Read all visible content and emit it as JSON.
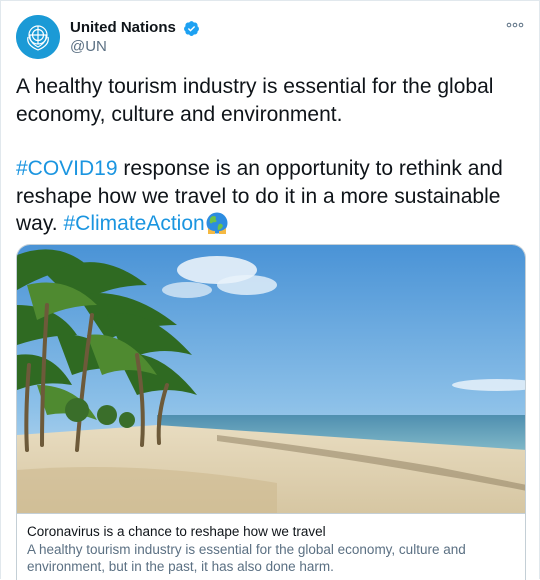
{
  "account": {
    "display_name": "United Nations",
    "handle": "@UN",
    "avatar_icon": "un-emblem-icon",
    "verified_icon": "verified-badge-icon",
    "brand_color": "#1b9ad6"
  },
  "tweet": {
    "line1": "A healthy tourism industry is essential for the global economy, culture and environment.",
    "hashtag1": "#COVID19",
    "line2_rest": " response is an opportunity to rethink and reshape how we travel to do it in a more sustainable way. ",
    "hashtag2": "#ClimateAction",
    "emoji_icon": "globe-emoji-icon",
    "link_color": "#1b95e0"
  },
  "card": {
    "image_icon": "beach-palm-trees-image",
    "title": "Coronavirus is a chance to reshape how we travel",
    "description": "A healthy tourism industry is essential for the global economy, culture and environment, but in the past, it has also done harm."
  },
  "menu": {
    "more_icon": "more-options-icon"
  }
}
